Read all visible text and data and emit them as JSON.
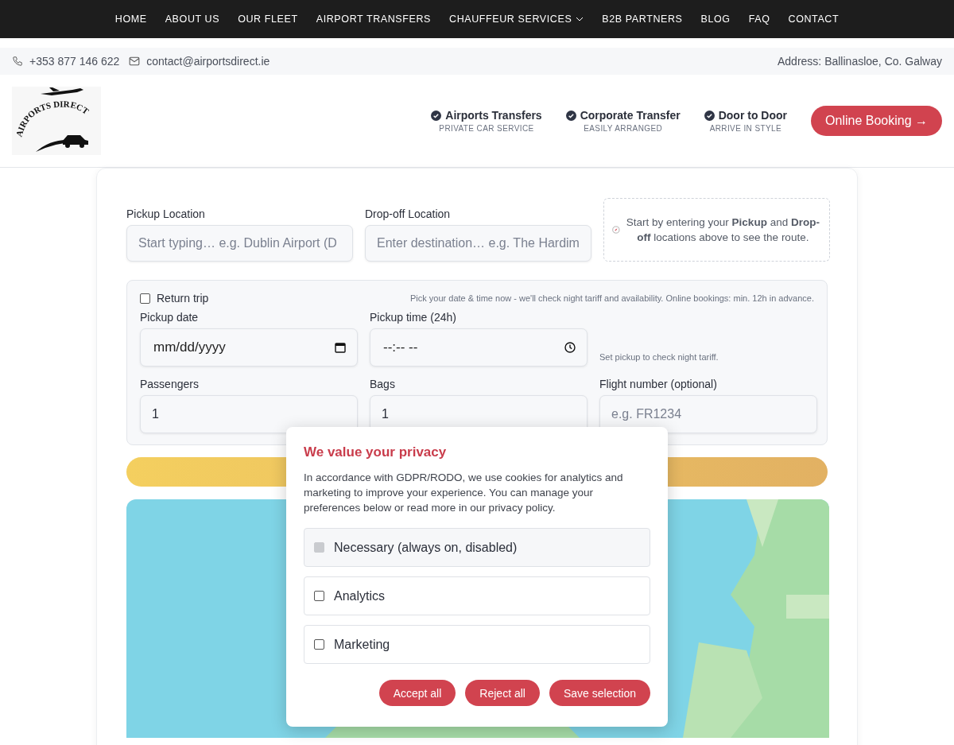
{
  "nav": {
    "items": [
      {
        "label": "HOME",
        "dropdown": false
      },
      {
        "label": "ABOUT US",
        "dropdown": false
      },
      {
        "label": "OUR FLEET",
        "dropdown": false
      },
      {
        "label": "AIRPORT TRANSFERS",
        "dropdown": false
      },
      {
        "label": "CHAUFFEUR SERVICES",
        "dropdown": true
      },
      {
        "label": "B2B PARTNERS",
        "dropdown": false
      },
      {
        "label": "BLOG",
        "dropdown": false
      },
      {
        "label": "FAQ",
        "dropdown": false
      },
      {
        "label": "CONTACT",
        "dropdown": false
      }
    ]
  },
  "contact_bar": {
    "phone": "+353 877 146 622",
    "email": "contact@airportsdirect.ie",
    "address": "Address: Ballinasloe, Co. Galway"
  },
  "header": {
    "logo_text": "AIRPORTS DIRECT",
    "features": [
      {
        "title": "Airports Transfers",
        "subtitle": "PRIVATE CAR SERVICE"
      },
      {
        "title": "Corporate Transfer",
        "subtitle": "EASILY ARRANGED"
      },
      {
        "title": "Door to Door",
        "subtitle": "ARRIVE IN STYLE"
      }
    ],
    "booking_button": "Online Booking →"
  },
  "form": {
    "pickup": {
      "label": "Pickup Location",
      "placeholder": "Start typing… e.g. Dublin Airport (D"
    },
    "dropoff": {
      "label": "Drop-off Location",
      "placeholder": "Enter destination… e.g. The Hardim"
    },
    "route_hint": "Start by entering your **Pickup** and **Drop-off** locations above to see the route.",
    "trip": {
      "return_trip": {
        "label": "Return trip",
        "checked": false
      },
      "note": "Pick your date & time now - we'll check night tariff and availability. Online bookings: min. 12h in advance.",
      "pickup_date": {
        "label": "Pickup date",
        "placeholder": "mm/dd/yyyy"
      },
      "pickup_time": {
        "label": "Pickup time (24h)",
        "placeholder": "--:-- --"
      },
      "tariff_note": "Set pickup to check night tariff.",
      "passengers": {
        "label": "Passengers",
        "value": "1"
      },
      "bags": {
        "label": "Bags",
        "value": "1"
      },
      "flight": {
        "label": "Flight number (optional)",
        "placeholder": "e.g. FR1234"
      }
    }
  },
  "cookie": {
    "title": "We value your privacy",
    "text": "In accordance with GDPR/RODO, we use cookies for analytics and marketing to improve your experience. You can manage your preferences below or read more in our privacy policy.",
    "options": [
      {
        "label": "Necessary (always on, disabled)",
        "checked": true,
        "disabled": true
      },
      {
        "label": "Analytics",
        "checked": false,
        "disabled": false
      },
      {
        "label": "Marketing",
        "checked": false,
        "disabled": false
      }
    ],
    "buttons": [
      "Accept all",
      "Reject all",
      "Save selection"
    ]
  }
}
